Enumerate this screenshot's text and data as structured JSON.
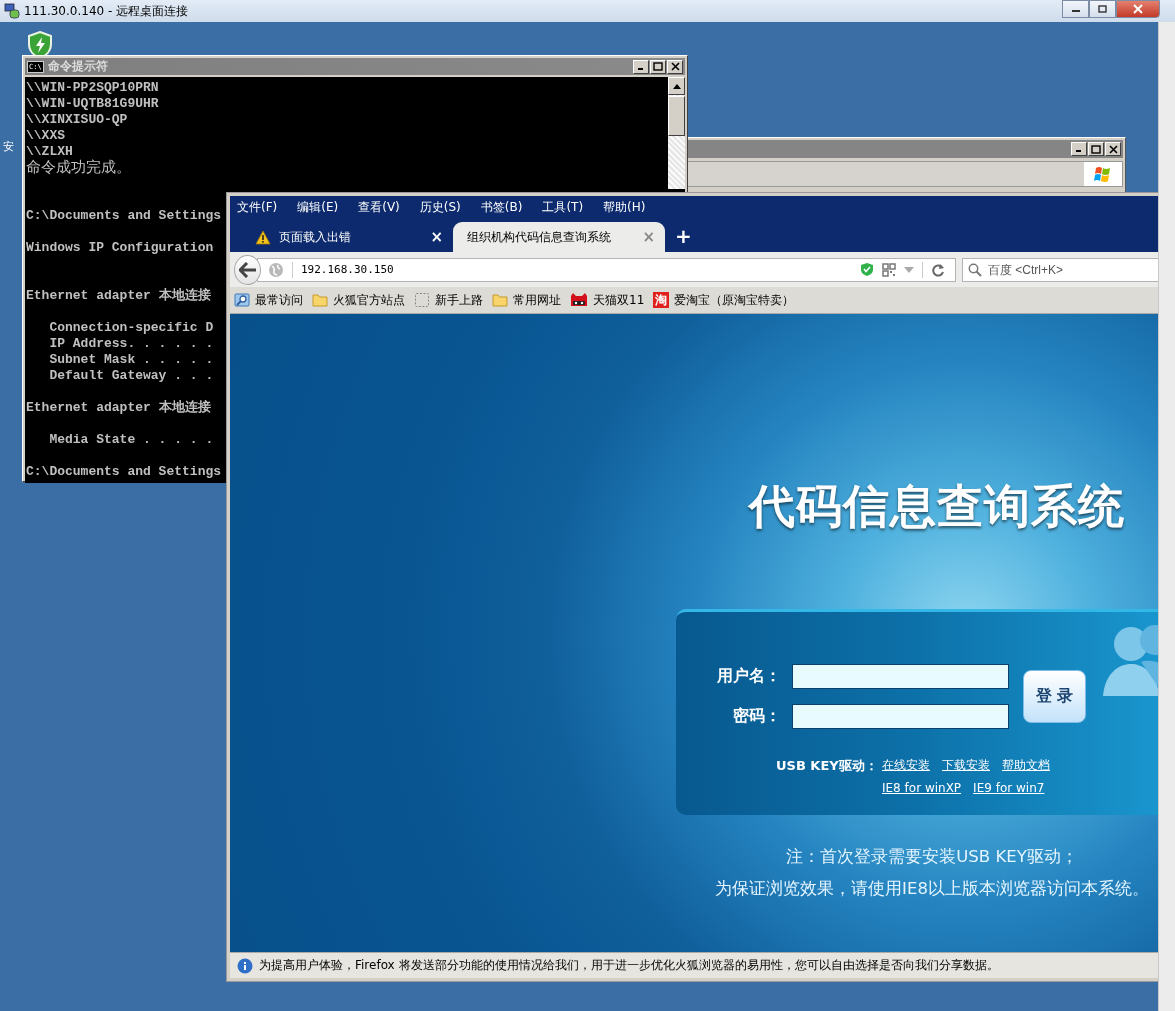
{
  "rdp_window": {
    "title": "111.30.0.140 - 远程桌面连接"
  },
  "desktop_icons": [
    {
      "label": "安"
    }
  ],
  "cmd_window": {
    "title": "命令提示符",
    "icon_text": "C:\\",
    "lines": [
      {
        "text": "\\\\WIN-PP2SQP10PRN"
      },
      {
        "text": "\\\\WIN-UQTB81G9UHR"
      },
      {
        "text": "\\\\XINXISUO-QP"
      },
      {
        "text": "\\\\XXS"
      },
      {
        "text": "\\\\ZLXH"
      },
      {
        "text": "命令成功完成。",
        "kind": "cjk"
      },
      {
        "text": "C:\\Documents and Settings",
        "kind": "wide"
      },
      {
        "text": "Windows IP Configuration",
        "kind": "spaced"
      },
      {
        "text": "Ethernet adapter 本地连接",
        "kind": "wide"
      },
      {
        "text": "   Connection-specific D",
        "kind": "spaced"
      },
      {
        "text": "   IP Address. . . . . ."
      },
      {
        "text": "   Subnet Mask . . . . ."
      },
      {
        "text": "   Default Gateway . . ."
      },
      {
        "text": "Ethernet adapter 本地连接",
        "kind": "spaced"
      },
      {
        "text": "   Media State . . . . .",
        "kind": "spaced"
      },
      {
        "text": "C:\\Documents and Settings",
        "kind": "spaced"
      }
    ]
  },
  "browser": {
    "menu": [
      "文件(F)",
      "编辑(E)",
      "查看(V)",
      "历史(S)",
      "书签(B)",
      "工具(T)",
      "帮助(H)"
    ],
    "tabs": [
      {
        "label": "页面载入出错",
        "kind": "error",
        "close": "×",
        "selected": false
      },
      {
        "label": "组织机构代码信息查询系统",
        "kind": "page",
        "close": "×",
        "selected": true
      }
    ],
    "new_tab": "+",
    "url": "192.168.30.150",
    "search": {
      "placeholder": "百度 <Ctrl+K>"
    },
    "bookmarks": [
      {
        "label": "最常访问",
        "kind": "smart"
      },
      {
        "label": "火狐官方站点",
        "kind": "folder"
      },
      {
        "label": "新手上路",
        "kind": "page"
      },
      {
        "label": "常用网址",
        "kind": "folder"
      },
      {
        "label": "天猫双11",
        "kind": "tmall"
      },
      {
        "label": "爱淘宝（原淘宝特卖）",
        "kind": "taobao",
        "icon_text": "淘"
      }
    ],
    "page": {
      "title": "代码信息查询系统",
      "login": {
        "username_label": "用户名：",
        "password_label": "密码：",
        "button": "登 录",
        "usb_label": "USB KEY驱动：",
        "link_rows": [
          [
            "在线安装",
            "下载安装",
            "帮助文档"
          ],
          [
            "IE8 for winXP",
            "IE9 for win7"
          ]
        ]
      },
      "notes": [
        "注：首次登录需要安装USB KEY驱动；",
        "为保证浏览效果，请使用IE8以上版本浏览器访问本系统。"
      ]
    },
    "notification": "为提高用户体验，Firefox 将发送部分功能的使用情况给我们，用于进一步优化火狐浏览器的易用性，您可以自由选择是否向我们分享数据。"
  }
}
